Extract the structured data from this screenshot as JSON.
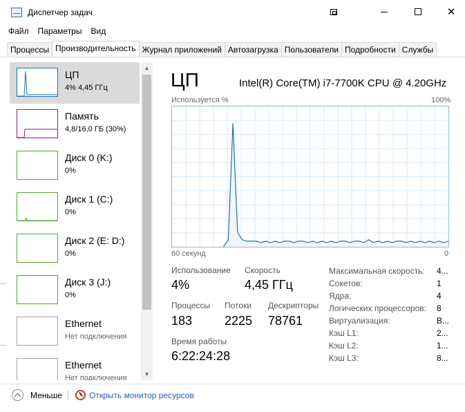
{
  "window": {
    "title": "Диспетчер задач",
    "icon": "task-manager-icon"
  },
  "menu": [
    "Файл",
    "Параметры",
    "Вид"
  ],
  "tabs": [
    {
      "label": "Процессы",
      "active": false
    },
    {
      "label": "Производительность",
      "active": true
    },
    {
      "label": "Журнал приложений",
      "active": false
    },
    {
      "label": "Автозагрузка",
      "active": false
    },
    {
      "label": "Пользователи",
      "active": false
    },
    {
      "label": "Подробности",
      "active": false
    },
    {
      "label": "Службы",
      "active": false
    }
  ],
  "sidebar": [
    {
      "name": "ЦП",
      "sub": "4% 4,45 ГГц",
      "color": "#1a6fa8",
      "selected": true
    },
    {
      "name": "Память",
      "sub": "4,8/16,0 ГБ (30%)",
      "color": "#8b1a8b",
      "selected": false
    },
    {
      "name": "Диск 0 (K:)",
      "sub": "0%",
      "color": "#4da62c",
      "selected": false
    },
    {
      "name": "Диск 1 (C:)",
      "sub": "0%",
      "color": "#4da62c",
      "selected": false
    },
    {
      "name": "Диск 2 (E: D:)",
      "sub": "0%",
      "color": "#4da62c",
      "selected": false
    },
    {
      "name": "Диск 3 (J:)",
      "sub": "0%",
      "color": "#4da62c",
      "selected": false
    },
    {
      "name": "Ethernet",
      "sub": "Нет подключения",
      "color": "#a0a0a0",
      "selected": false
    },
    {
      "name": "Ethernet",
      "sub": "Нет подключения",
      "color": "#a0a0a0",
      "selected": false
    }
  ],
  "main": {
    "title": "ЦП",
    "cpu_name": "Intel(R) Core(TM) i7-7700K CPU @ 4.20GHz",
    "graph_label_left": "Используется %",
    "graph_label_right": "100%",
    "axis_left": "60 секунд",
    "axis_right": "0",
    "stats": {
      "usage_label": "Использование",
      "usage_value": "4%",
      "speed_label": "Скорость",
      "speed_value": "4,45 ГГц",
      "processes_label": "Процессы",
      "processes_value": "183",
      "threads_label": "Потоки",
      "threads_value": "2225",
      "handles_label": "Дескрипторы",
      "handles_value": "78761",
      "uptime_label": "Время работы",
      "uptime_value": "6:22:24:28"
    },
    "specs": [
      {
        "label": "Максимальная скорость:",
        "value": "4..."
      },
      {
        "label": "Сокетов:",
        "value": "1"
      },
      {
        "label": "Ядра:",
        "value": "4"
      },
      {
        "label": "Логических процессоров:",
        "value": "8"
      },
      {
        "label": "Виртуализация:",
        "value": "В..."
      },
      {
        "label": "Кэш L1:",
        "value": "2..."
      },
      {
        "label": "Кэш L2:",
        "value": "1..."
      },
      {
        "label": "Кэш L3:",
        "value": "8..."
      }
    ]
  },
  "footer": {
    "less_label": "Меньше",
    "resmon_label": "Открыть монитор ресурсов"
  },
  "colors": {
    "cpu_line": "#1a6fa8",
    "cpu_fill": "#f1f6fa",
    "grid": "#d9eaf7",
    "link": "#1c5fb8"
  },
  "chart_data": {
    "type": "area",
    "title": "",
    "xlabel": "60 секунд",
    "ylabel": "Используется %",
    "ylim": [
      0,
      100
    ],
    "series": [
      {
        "values": [
          0,
          0,
          0,
          0,
          0,
          0,
          0,
          0,
          0,
          0,
          0,
          0,
          0,
          0,
          0,
          0,
          0,
          0,
          0,
          0,
          0,
          0,
          0,
          0,
          0,
          0,
          0,
          0,
          0,
          0,
          0,
          0,
          0,
          0,
          0,
          0,
          0,
          0,
          0,
          0,
          0,
          0,
          0,
          0,
          0,
          0,
          0,
          0,
          0,
          0,
          0,
          0,
          0,
          0,
          0,
          0,
          0,
          0,
          0,
          0
        ]
      }
    ],
    "cpu_curve": [
      0,
      0,
      0,
      0,
      0,
      0,
      0,
      0,
      0,
      0,
      0,
      0,
      5,
      88,
      10,
      5,
      4,
      4,
      4,
      3,
      4,
      3,
      4,
      3,
      4,
      4,
      3,
      4,
      4,
      3,
      4,
      3,
      4,
      3,
      4,
      3,
      4,
      4,
      3,
      4,
      4,
      3,
      5,
      3,
      4,
      3,
      4,
      3,
      4,
      4,
      3,
      4,
      3,
      4,
      3,
      4,
      3,
      4,
      3,
      4
    ]
  }
}
